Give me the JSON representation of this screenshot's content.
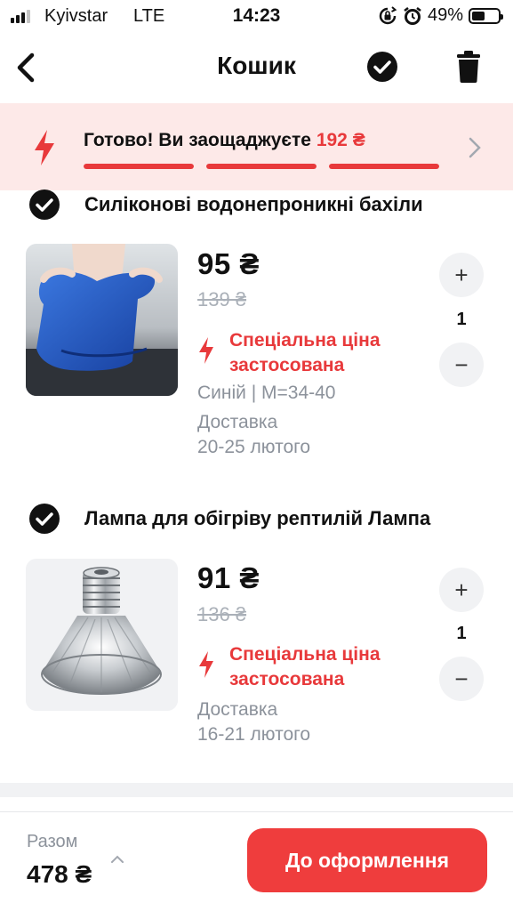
{
  "status_bar": {
    "carrier": "Kyivstar",
    "network": "LTE",
    "time": "14:23",
    "battery_percent": "49%",
    "battery_level": 0.49,
    "icons": [
      "signal-icon",
      "orientation-lock-icon",
      "alarm-icon",
      "battery-icon"
    ]
  },
  "header": {
    "title": "Кошик",
    "icons": [
      "back-icon",
      "select-all-icon",
      "trash-icon"
    ]
  },
  "banner": {
    "text": "Готово! Ви заощаджуєте",
    "amount": "192 ₴",
    "progress": [
      1,
      1,
      1
    ],
    "icons": [
      "lightning-icon",
      "chevron-right-icon"
    ]
  },
  "items": [
    {
      "checked": true,
      "title": "Силіконові водонепроникні бахіли",
      "price": "95 ₴",
      "old_price": "139 ₴",
      "special": "Спеціальна ціна застосована",
      "variant": "Синій | M=34-40",
      "delivery_label": "Доставка",
      "delivery_dates": "20-25 лютого",
      "quantity": "1",
      "plus": "+",
      "minus": "−"
    },
    {
      "checked": true,
      "title": "Лампа для обігріву рептилій Лампа",
      "price": "91 ₴",
      "old_price": "136 ₴",
      "special": "Спеціальна ціна застосована",
      "delivery_label": "Доставка",
      "delivery_dates": "16-21 лютого",
      "quantity": "1",
      "plus": "+",
      "minus": "−"
    }
  ],
  "footer": {
    "total_label": "Разом",
    "total_value": "478 ₴",
    "checkout_label": "До оформлення"
  },
  "colors": {
    "accent": "#ef3d3d",
    "banner_bg": "#fde9e8",
    "muted_text": "#8c929b"
  }
}
